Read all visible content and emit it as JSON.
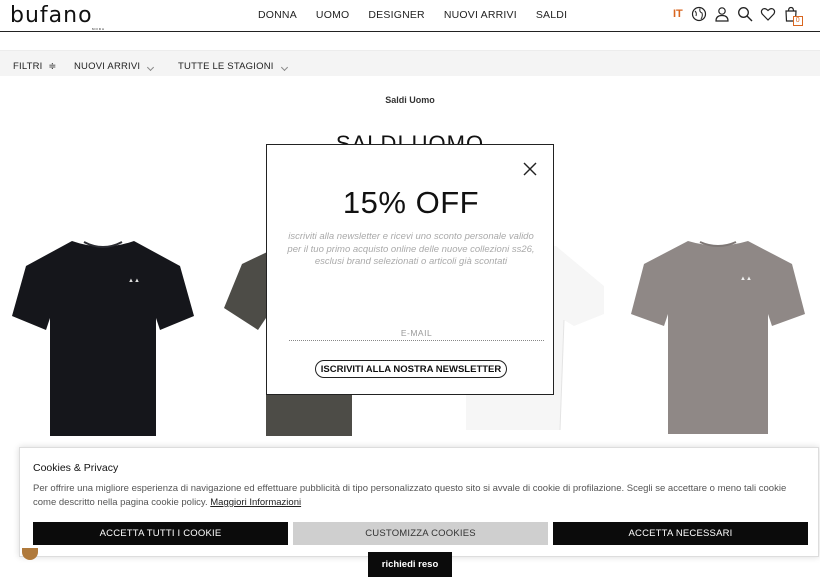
{
  "header": {
    "logo_text": "bufano",
    "logo_sub": "MODA",
    "nav": [
      "DONNA",
      "UOMO",
      "DESIGNER",
      "NUOVI ARRIVI",
      "SALDI"
    ],
    "lang": "IT",
    "cart_count": "0",
    "accent_color": "#d9661f"
  },
  "filters": {
    "filter_label": "FILTRI",
    "new_arrivals": "NUOVI ARRIVI",
    "seasons": "TUTTE LE STAGIONI"
  },
  "page": {
    "breadcrumb": "Saldi Uomo",
    "title": "SALDI UOMO"
  },
  "products": [
    {
      "color": "#15161b"
    },
    {
      "color": "#4d4c47"
    },
    {
      "color": "#f4f4f4"
    },
    {
      "color": "#8f8886"
    }
  ],
  "modal": {
    "title": "15% OFF",
    "text": "iscriviti alla newsletter e ricevi uno sconto personale valido per il tuo primo acquisto online delle nuove collezioni ss26, esclusi brand selezionati o articoli già scontati",
    "email_placeholder": "E-MAIL",
    "subscribe_label": "ISCRIVITI ALLA NOSTRA NEWSLETTER"
  },
  "cookie": {
    "title": "Cookies & Privacy",
    "text": "Per offrire una migliore esperienza di navigazione ed effettuare pubblicità di tipo personalizzato questo sito si avvale di cookie di profilazione. Scegli se accettare o meno tali cookie come descritto nella pagina cookie policy.",
    "link": "Maggiori Informazioni",
    "accept_all": "ACCETTA TUTTI I COOKIE",
    "customize": "CUSTOMIZZA COOKIES",
    "accept_necessary": "ACCETTA NECESSARI"
  },
  "return_button": "richiedi reso"
}
